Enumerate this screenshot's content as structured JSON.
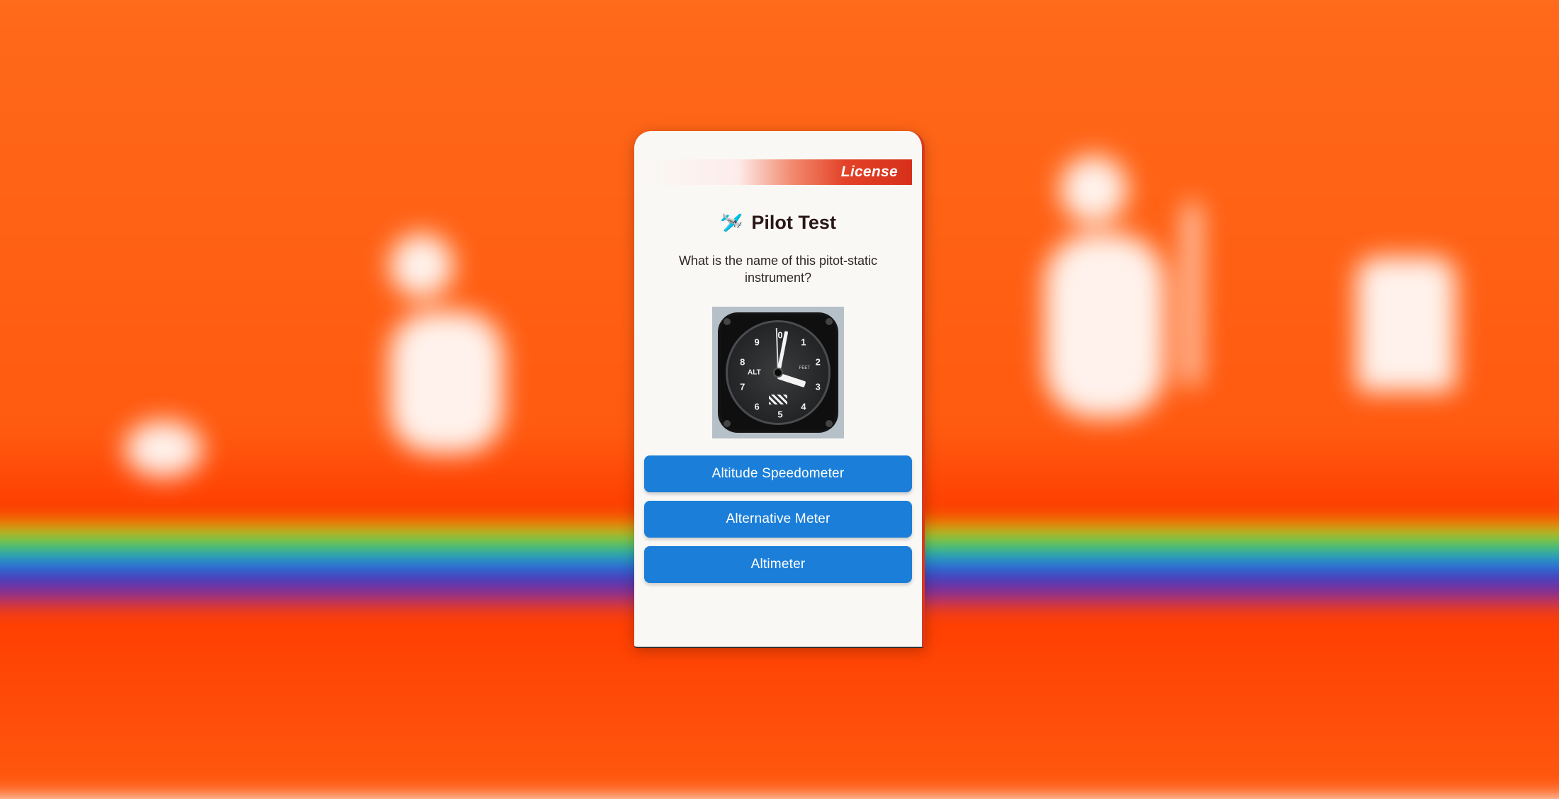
{
  "header": {
    "label": "License"
  },
  "title": {
    "icon": "🛩️",
    "text": "Pilot Test"
  },
  "question": "What is the name of this pitot-static instrument?",
  "instrument": {
    "alt_label": "ALT",
    "unit_label": "FEET",
    "dial_numbers": [
      "0",
      "1",
      "2",
      "3",
      "4",
      "5",
      "6",
      "7",
      "8",
      "9"
    ],
    "long_needle_deg": -79,
    "short_needle_deg": 18,
    "thin_needle_deg": -92
  },
  "answers": [
    {
      "label": "Altitude Speedometer"
    },
    {
      "label": "Alternative Meter"
    },
    {
      "label": "Altimeter"
    }
  ],
  "colors": {
    "button": "#1b7fd9",
    "header_accent": "#d7301a",
    "card_bg": "#faf8f5"
  }
}
